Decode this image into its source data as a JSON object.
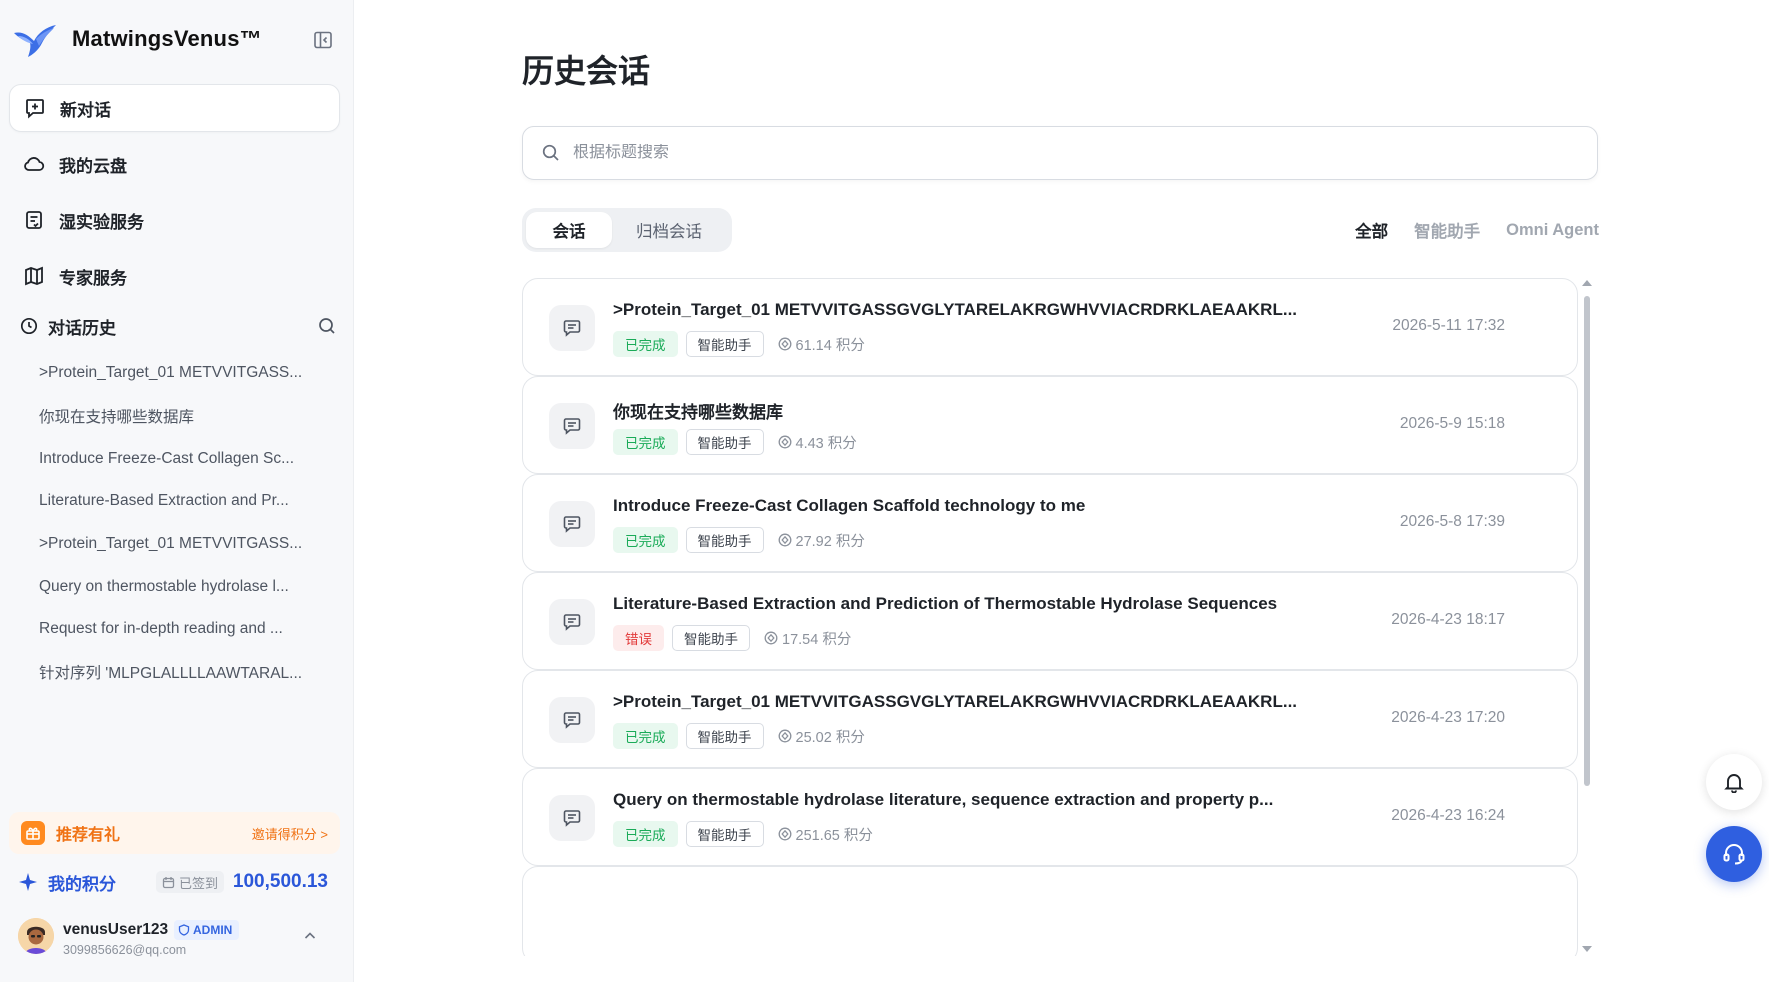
{
  "brand": {
    "name": "MatwingsVenus™"
  },
  "nav": [
    {
      "label": "新对话",
      "icon": "plus-square-icon"
    },
    {
      "label": "我的云盘",
      "icon": "cloud-icon"
    },
    {
      "label": "湿实验服务",
      "icon": "document-icon"
    },
    {
      "label": "专家服务",
      "icon": "map-icon"
    }
  ],
  "history": {
    "title": "对话历史",
    "items": [
      ">Protein_Target_01 METVVITGASS...",
      "你现在支持哪些数据库",
      "Introduce Freeze-Cast Collagen Sc...",
      "Literature-Based Extraction and Pr...",
      ">Protein_Target_01 METVVITGASS...",
      "Query on thermostable hydrolase l...",
      "Request for in-depth reading and ...",
      "针对序列 'MLPGLALLLLAAWTARAL..."
    ]
  },
  "referral": {
    "label": "推荐有礼",
    "invite": "邀请得积分 >"
  },
  "points": {
    "label": "我的积分",
    "checkin": "已签到",
    "value": "100,500.13"
  },
  "user": {
    "name": "venusUser123",
    "badge": "ADMIN",
    "email": "3099856626@qq.com"
  },
  "main": {
    "title": "历史会话",
    "search_placeholder": "根据标题搜索",
    "segments": [
      "会话",
      "归档会话"
    ],
    "filters": [
      "全部",
      "智能助手",
      "Omni Agent"
    ],
    "conversations": [
      {
        "title": ">Protein_Target_01 METVVITGASSGVGLYTARELAKRGWHVVIACRDRKLAEAAKRL...",
        "status": "已完成",
        "status_type": "done",
        "tag": "智能助手",
        "cost": "61.14 积分",
        "time": "2026-5-11 17:32"
      },
      {
        "title": "你现在支持哪些数据库",
        "status": "已完成",
        "status_type": "done",
        "tag": "智能助手",
        "cost": "4.43 积分",
        "time": "2026-5-9 15:18"
      },
      {
        "title": "Introduce Freeze-Cast Collagen Scaffold technology to me",
        "status": "已完成",
        "status_type": "done",
        "tag": "智能助手",
        "cost": "27.92 积分",
        "time": "2026-5-8 17:39"
      },
      {
        "title": "Literature-Based Extraction and Prediction of Thermostable Hydrolase Sequences",
        "status": "错误",
        "status_type": "error",
        "tag": "智能助手",
        "cost": "17.54 积分",
        "time": "2026-4-23 18:17"
      },
      {
        "title": ">Protein_Target_01 METVVITGASSGVGLYTARELAKRGWHVVIACRDRKLAEAAKRL...",
        "status": "已完成",
        "status_type": "done",
        "tag": "智能助手",
        "cost": "25.02 积分",
        "time": "2026-4-23 17:20"
      },
      {
        "title": "Query on thermostable hydrolase literature, sequence extraction and property p...",
        "status": "已完成",
        "status_type": "done",
        "tag": "智能助手",
        "cost": "251.65 积分",
        "time": "2026-4-23 16:24"
      }
    ]
  },
  "colors": {
    "accent": "#2b57d9",
    "success": "#1aab58",
    "error": "#e23b3b",
    "referral": "#f07214"
  }
}
